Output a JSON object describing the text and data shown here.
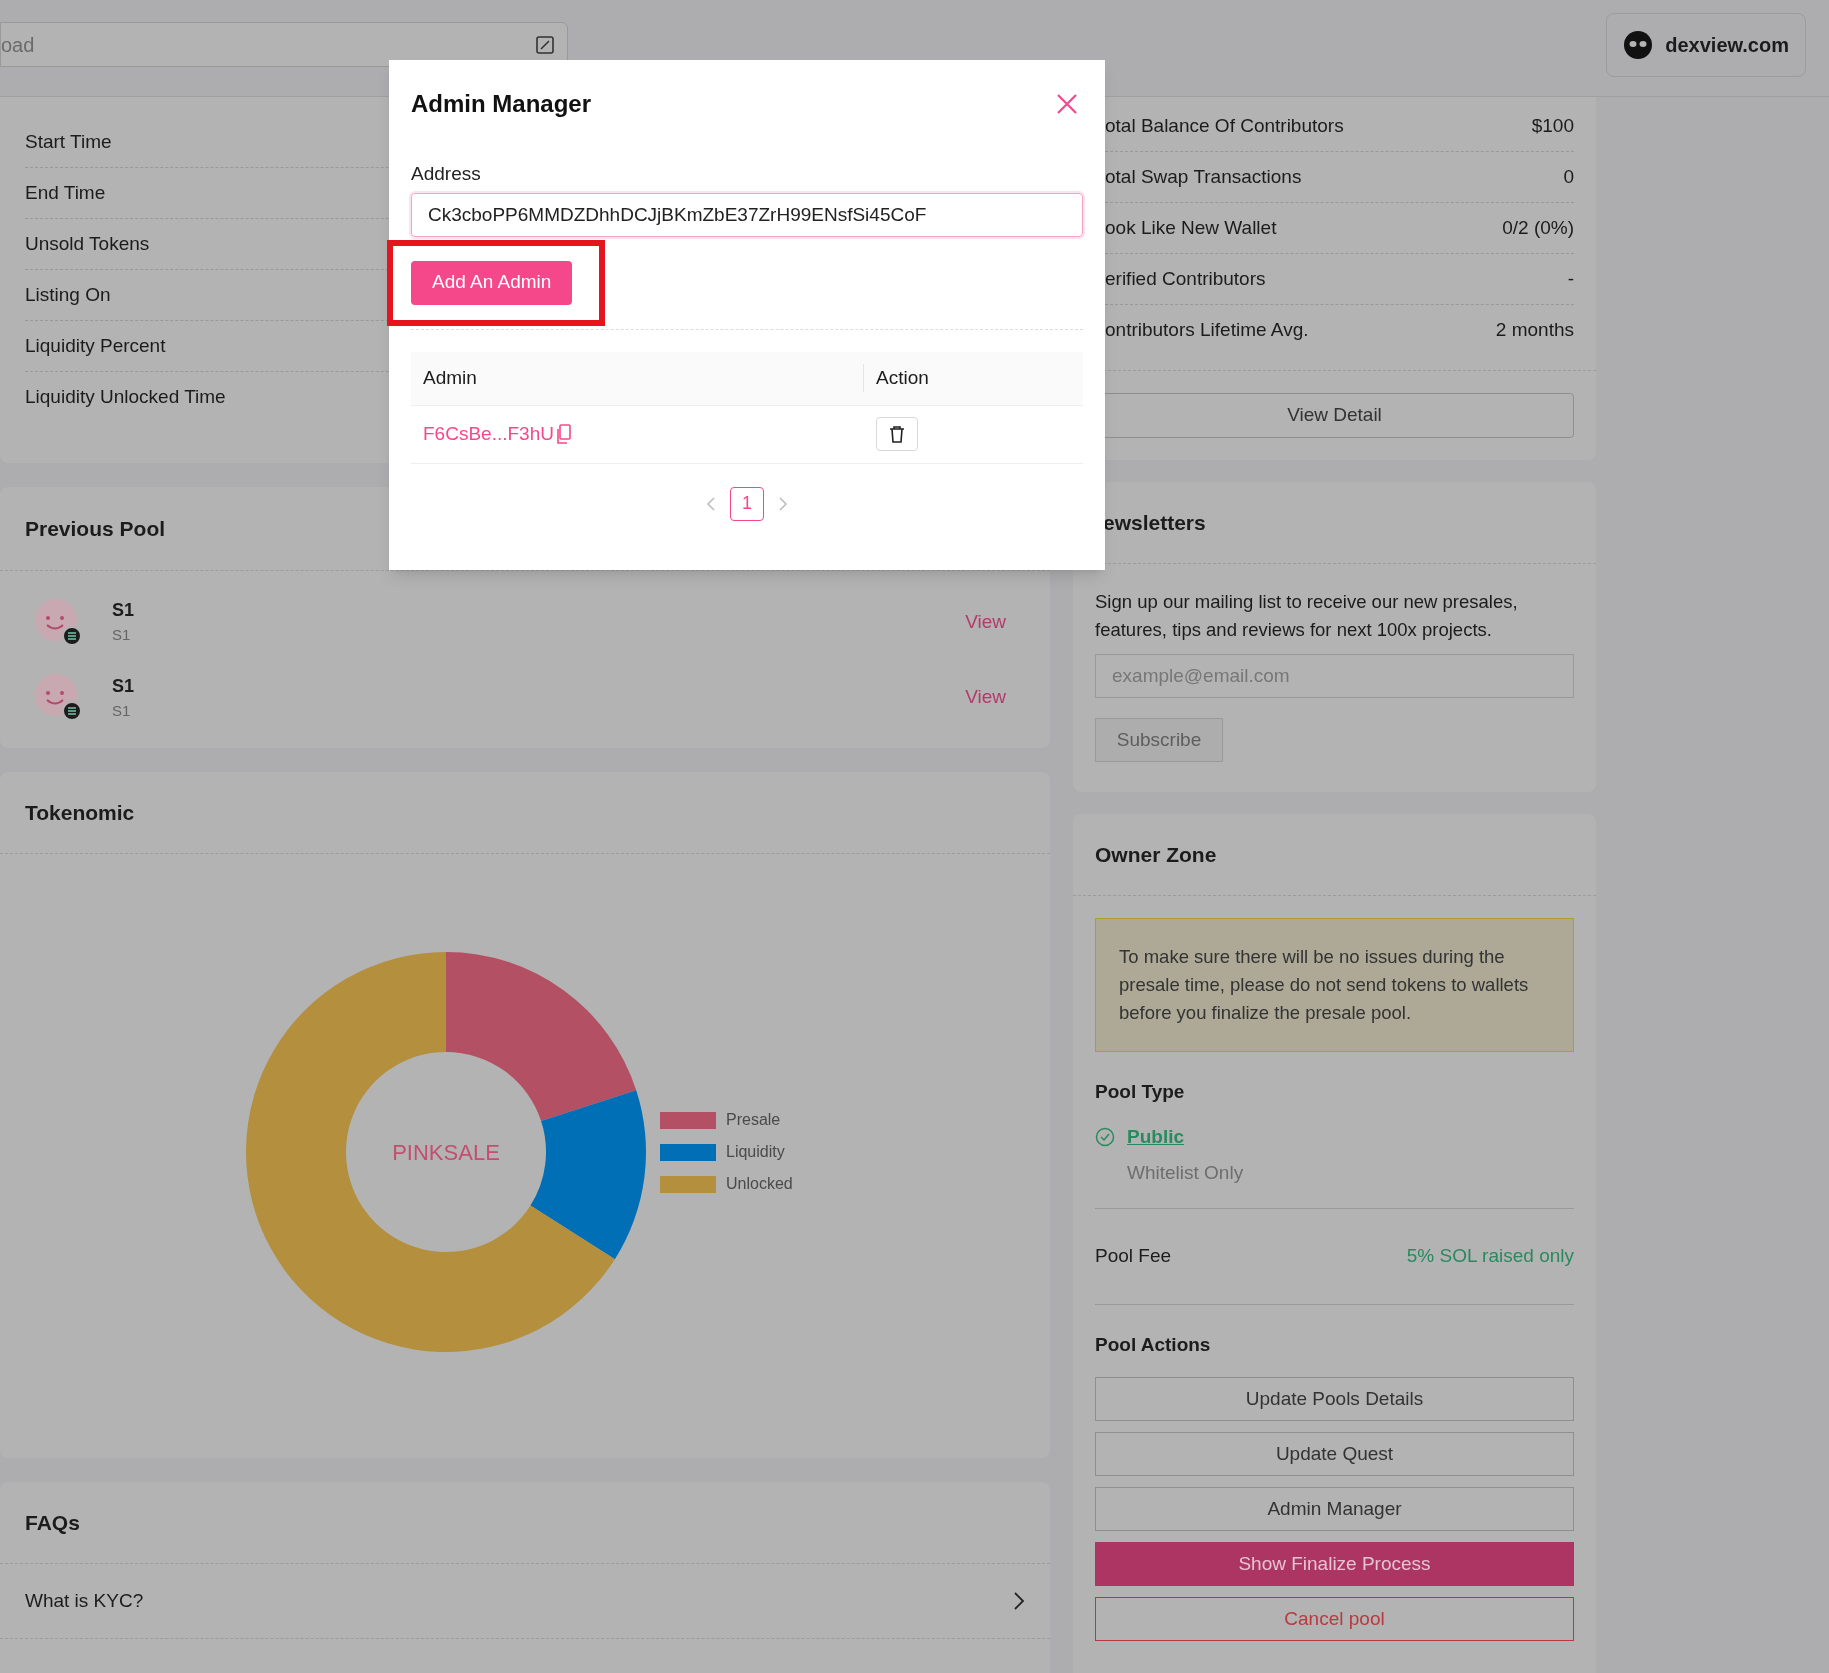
{
  "top_bar": {
    "search_value": "oad",
    "site_button": "dexview.com"
  },
  "pool_info": {
    "rows": [
      {
        "label": "Start Time"
      },
      {
        "label": "End Time"
      },
      {
        "label": "Unsold Tokens"
      },
      {
        "label": "Listing On"
      },
      {
        "label": "Liquidity Percent"
      },
      {
        "label": "Liquidity Unlocked Time"
      }
    ]
  },
  "previous_pool": {
    "title": "Previous Pool",
    "items": [
      {
        "name": "S1",
        "symbol": "S1",
        "link": "View"
      },
      {
        "name": "S1",
        "symbol": "S1",
        "link": "View"
      }
    ]
  },
  "tokenomic": {
    "title": "Tokenomic",
    "center_label": "PINKSALE",
    "legend": [
      {
        "label": "Presale",
        "color": "#b35064"
      },
      {
        "label": "Liquidity",
        "color": "#016fb5"
      },
      {
        "label": "Unlocked",
        "color": "#b38f3e"
      }
    ]
  },
  "faqs": {
    "title": "FAQs",
    "items": [
      {
        "question": "What is KYC?"
      }
    ]
  },
  "stats": {
    "rows": [
      {
        "label": "otal Balance Of Contributors",
        "value": "$100"
      },
      {
        "label": "otal Swap Transactions",
        "value": "0"
      },
      {
        "label": "ook Like New Wallet",
        "value": "0/2 (0%)"
      },
      {
        "label": "erified Contributors",
        "value": "-"
      },
      {
        "label": "ontributors Lifetime Avg.",
        "value": "2 months"
      }
    ],
    "button": "View Detail"
  },
  "newsletters": {
    "title": "ewsletters",
    "text": "Sign up our mailing list to receive our new presales, features, tips and reviews for next 100x projects.",
    "placeholder": "example@email.com",
    "button": "Subscribe"
  },
  "owner_zone": {
    "title": "Owner Zone",
    "notice": "To make sure there will be no issues during the presale time, please do not send tokens to wallets before you finalize the presale pool.",
    "pool_type_title": "Pool Type",
    "pool_types": [
      {
        "label": "Public",
        "selected": true
      },
      {
        "label": "Whitelist Only",
        "selected": false
      }
    ],
    "fee_label": "Pool Fee",
    "fee_value": "5% SOL raised only",
    "actions_title": "Pool Actions",
    "actions": [
      {
        "label": "Update Pools Details",
        "kind": "outline"
      },
      {
        "label": "Update Quest",
        "kind": "outline"
      },
      {
        "label": "Admin Manager",
        "kind": "outline"
      },
      {
        "label": "Show Finalize Process",
        "kind": "primary"
      },
      {
        "label": "Cancel pool",
        "kind": "danger"
      }
    ]
  },
  "modal": {
    "title": "Admin Manager",
    "address_label": "Address",
    "address_value": "Ck3cboPP6MMDZDhhDCJjBKmZbE37ZrH99ENsfSi45CoF",
    "add_button": "Add An Admin",
    "columns": [
      "Admin",
      "Action"
    ],
    "admins": [
      {
        "address": "F6CsBe...F3hU"
      }
    ],
    "pages": [
      {
        "label": "1",
        "selected": true
      }
    ]
  }
}
